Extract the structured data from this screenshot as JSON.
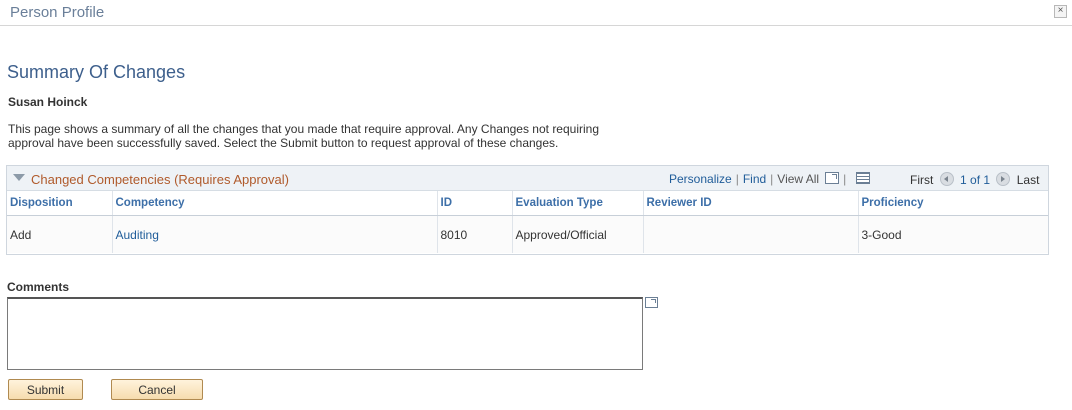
{
  "window": {
    "title": "Person Profile",
    "close_glyph": "×"
  },
  "page": {
    "title": "Summary Of Changes",
    "person_name": "Susan Hoinck",
    "instructions": "This page shows a summary of all the changes that you made that require approval. Any Changes not requiring approval have been successfully saved. Select the Submit button to request approval of these changes."
  },
  "grid": {
    "title": "Changed Competencies (Requires Approval)",
    "personalize": "Personalize",
    "find": "Find",
    "view_all": "View All",
    "sep": "|",
    "first": "First",
    "range": "1 of 1",
    "last": "Last",
    "columns": [
      "Disposition",
      "Competency",
      "ID",
      "Evaluation Type",
      "Reviewer ID",
      "Proficiency"
    ],
    "rows": [
      {
        "disposition": "Add",
        "competency": "Auditing",
        "id": "8010",
        "evaluation_type": "Approved/Official",
        "reviewer_id": "",
        "proficiency": "3-Good"
      }
    ]
  },
  "comments": {
    "label": "Comments",
    "value": ""
  },
  "buttons": {
    "submit": "Submit",
    "cancel": "Cancel"
  },
  "colors": {
    "title_blue": "#3d5f8c",
    "link_blue": "#1f5c99",
    "grid_title": "#b05a2b",
    "button_fill": "#f6dcae"
  }
}
